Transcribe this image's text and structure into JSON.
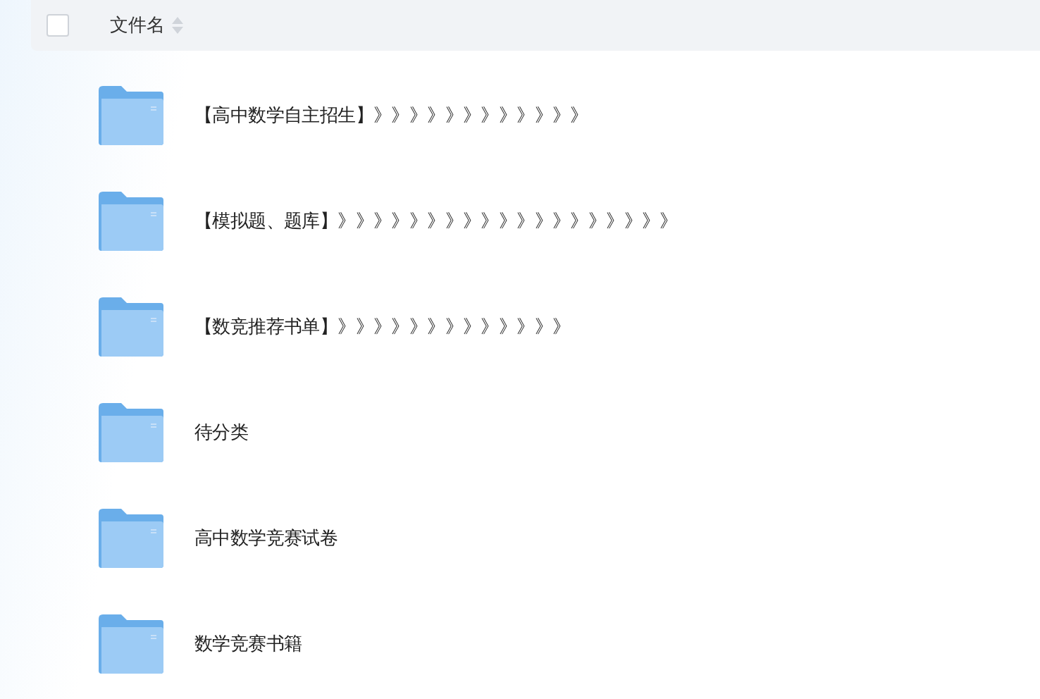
{
  "header": {
    "checked": false,
    "column": "文件名"
  },
  "files": [
    {
      "name": "【高中数学自主招生】》》》》》》》》》》》》"
    },
    {
      "name": "【模拟题、题库】》》》》》》》》》》》》》》》》》》》"
    },
    {
      "name": "【数竞推荐书单】》》》》》》》》》》》》》"
    },
    {
      "name": "待分类"
    },
    {
      "name": "高中数学竞赛试卷"
    },
    {
      "name": "数学竞赛书籍"
    }
  ]
}
